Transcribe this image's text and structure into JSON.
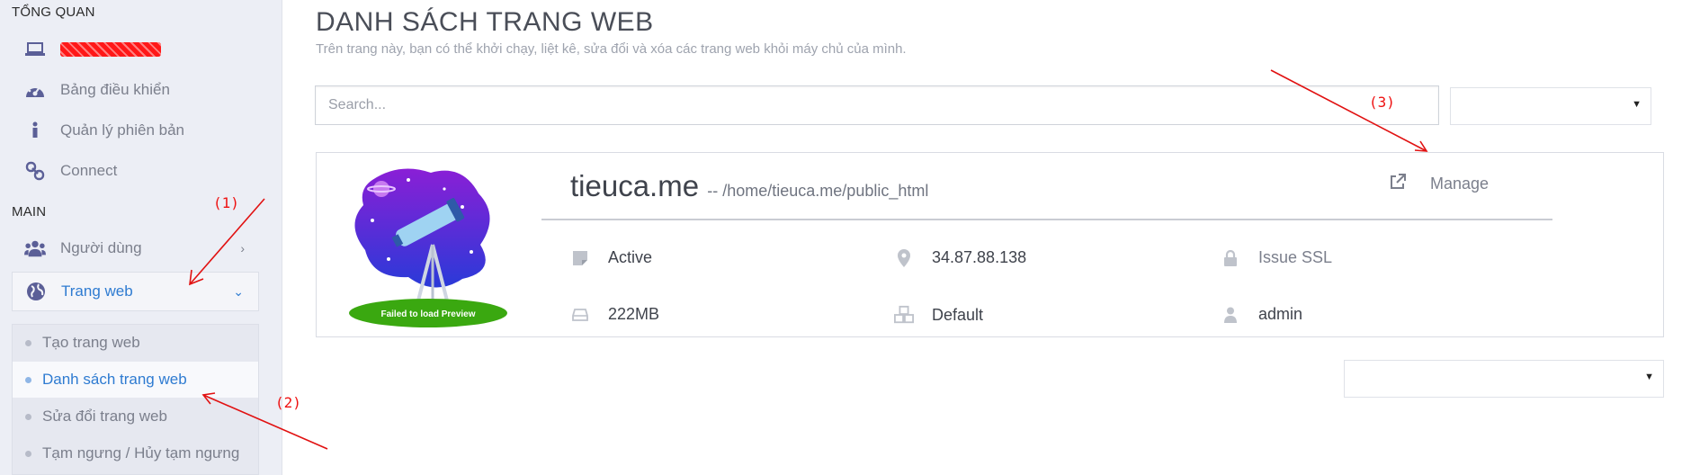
{
  "sidebar": {
    "overview_heading": "TỔNG QUAN",
    "overview_items": [
      {
        "label": "",
        "icon": "laptop-icon"
      },
      {
        "label": "Bảng điều khiển",
        "icon": "dashboard-icon"
      },
      {
        "label": "Quản lý phiên bản",
        "icon": "info-icon"
      },
      {
        "label": "Connect",
        "icon": "link-icon"
      }
    ],
    "main_heading": "MAIN",
    "main_items": [
      {
        "label": "Người dùng",
        "icon": "users-icon",
        "chevron": "›"
      },
      {
        "label": "Trang web",
        "icon": "globe-icon",
        "chevron": "⌄"
      }
    ],
    "sub_items": [
      {
        "label": "Tạo trang web"
      },
      {
        "label": "Danh sách trang web"
      },
      {
        "label": "Sửa đổi trang web"
      },
      {
        "label": "Tạm ngưng / Hủy tạm ngưng"
      }
    ]
  },
  "page": {
    "title": "DANH SÁCH TRANG WEB",
    "subtitle": "Trên trang này, bạn có thể khởi chạy, liệt kê, sửa đổi và xóa các trang web khỏi máy chủ của mình.",
    "search_placeholder": "Search...",
    "select_top_value": "",
    "select_bottom_value": ""
  },
  "site_card": {
    "preview_text": "Failed to load Preview",
    "domain": "tieuca.me",
    "path": "-- /home/tieuca.me/public_html",
    "manage_label": "Manage",
    "status": "Active",
    "ip": "34.87.88.138",
    "ssl": "Issue SSL",
    "disk": "222MB",
    "package": "Default",
    "owner": "admin"
  },
  "annotations": [
    "(1)",
    "(2)",
    "(3)"
  ],
  "colors": {
    "accent": "#2e7bd1",
    "sidebar_bg": "#eceef5",
    "annotation_red": "#e11111",
    "icon_purple": "#5b5f97"
  }
}
